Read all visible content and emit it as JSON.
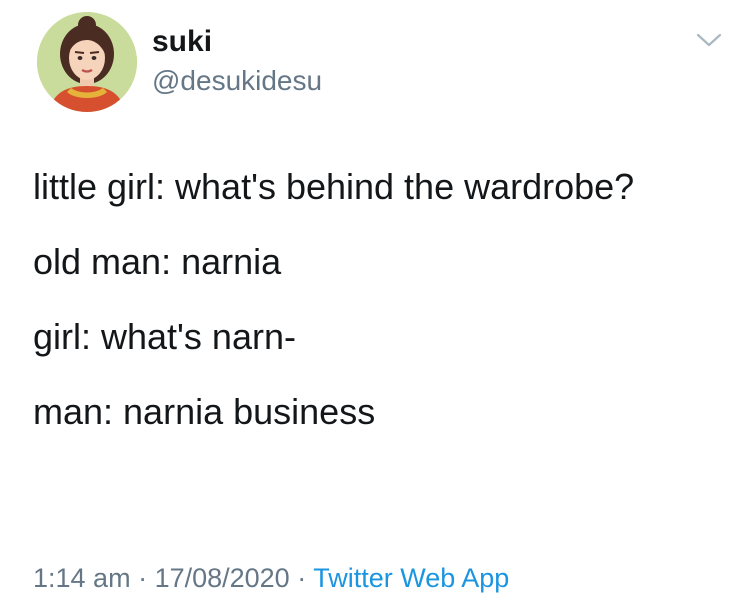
{
  "user": {
    "display_name": "suki",
    "handle": "@desukidesu",
    "avatar_icon": "profile-avatar"
  },
  "menu": {
    "icon": "chevron-down-icon"
  },
  "tweet": {
    "paragraphs": [
      "little girl: what's behind the wardrobe?",
      "old man: narnia",
      "girl: what's narn-",
      "man: narnia business"
    ]
  },
  "meta": {
    "time": "1:14 am",
    "separator1": " · ",
    "date": "17/08/2020",
    "separator2": " · ",
    "source": "Twitter Web App"
  },
  "colors": {
    "text": "#14171a",
    "secondary": "#657786",
    "link": "#1b95e0",
    "avatar_bg": "#c9dc9b"
  }
}
